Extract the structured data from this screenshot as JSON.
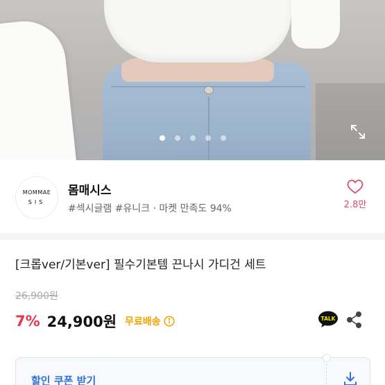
{
  "seller": {
    "logo_line1": "MOMMAE",
    "logo_line2": "SIS",
    "name": "몸매시스",
    "tags": "#섹시글램 #유니크 · 마켓 만족도 94%",
    "like_count": "2.8만"
  },
  "carousel": {
    "total": 5,
    "active_index": 0
  },
  "product": {
    "title": "[크롭ver/기본ver] 필수기본템 끈나시 가디건 세트",
    "original_price": "26,900원",
    "discount": "7%",
    "price": "24,900원",
    "shipping": "무료배송"
  },
  "actions": {
    "talk_label": "TALK"
  },
  "coupon": {
    "label": "할인 쿠폰 받기"
  },
  "colors": {
    "accent_red": "#e8344e",
    "shipping_orange": "#f5a200",
    "coupon_blue": "#2f6fdc",
    "like_pink": "#e04a6a"
  },
  "icons": [
    "expand-icon",
    "heart-icon",
    "info-icon",
    "kakao-talk-icon",
    "share-icon",
    "download-icon"
  ]
}
